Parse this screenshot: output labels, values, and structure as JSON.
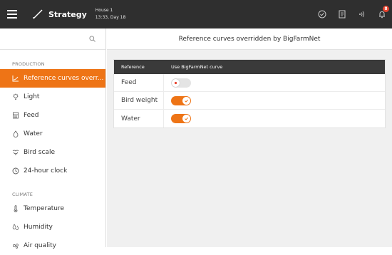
{
  "header": {
    "menu_icon": "hamburger-icon",
    "strategy_icon": "strategy-curve-icon",
    "strategy_label": "Strategy",
    "house_name": "House 1",
    "house_time": "13:33, Day 18",
    "icons": [
      "tasks-icon",
      "report-icon",
      "wifi-signal-icon",
      "alarm-bell-icon"
    ],
    "alarm_count": "8"
  },
  "sidebar": {
    "search_icon": "search-icon",
    "production_title": "PRODUCTION",
    "production_items": [
      {
        "label": "Reference curves overr...",
        "icon": "curve-icon"
      },
      {
        "label": "Light",
        "icon": "lightbulb-icon"
      },
      {
        "label": "Feed",
        "icon": "feed-icon"
      },
      {
        "label": "Water",
        "icon": "water-drop-icon"
      },
      {
        "label": "Bird scale",
        "icon": "bird-icon"
      },
      {
        "label": "24-hour clock",
        "icon": "clock-icon"
      }
    ],
    "climate_title": "CLIMATE",
    "climate_items": [
      {
        "label": "Temperature",
        "icon": "thermometer-icon"
      },
      {
        "label": "Humidity",
        "icon": "humidity-icon"
      },
      {
        "label": "Air quality",
        "icon": "air-quality-icon"
      }
    ]
  },
  "main": {
    "title": "Reference curves overridden by BigFarmNet",
    "table": {
      "col1": "Reference",
      "col2": "Use BigFarmNet curve",
      "rows": [
        {
          "label": "Feed",
          "enabled": false
        },
        {
          "label": "Bird weight",
          "enabled": true
        },
        {
          "label": "Water",
          "enabled": true
        }
      ]
    }
  },
  "colors": {
    "accent": "#ee7416",
    "topbar": "#2f2f2f",
    "alarm": "#e8432e"
  }
}
